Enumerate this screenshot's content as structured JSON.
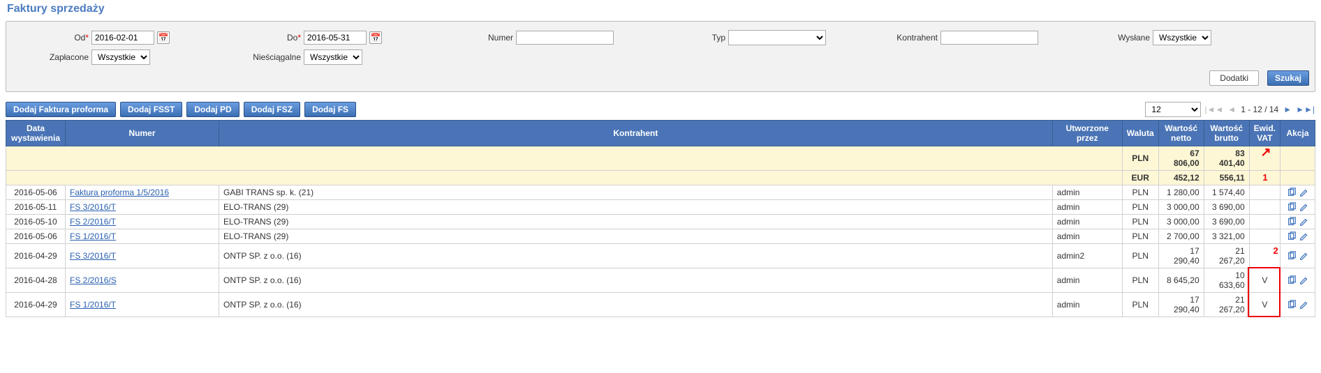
{
  "title": "Faktury sprzedaży",
  "filters": {
    "od": {
      "label": "Od",
      "value": "2016-02-01"
    },
    "do": {
      "label": "Do",
      "value": "2016-05-31"
    },
    "numer": {
      "label": "Numer",
      "value": ""
    },
    "typ": {
      "label": "Typ",
      "value": ""
    },
    "kontrahent": {
      "label": "Kontrahent",
      "value": ""
    },
    "wyslane": {
      "label": "Wysłane",
      "value": "Wszystkie"
    },
    "zaplacone": {
      "label": "Zapłacone",
      "value": "Wszystkie"
    },
    "niesciagalne": {
      "label": "Nieściągalne",
      "value": "Wszystkie"
    },
    "dodatki": "Dodatki",
    "szukaj": "Szukaj"
  },
  "actions": {
    "proforma": "Dodaj Faktura proforma",
    "fsst": "Dodaj FSST",
    "pd": "Dodaj PD",
    "fsz": "Dodaj FSZ",
    "fs": "Dodaj FS"
  },
  "pager": {
    "page_size": "12",
    "status": "1 - 12 / 14"
  },
  "columns": {
    "date": "Data wystawienia",
    "numer": "Numer",
    "kontrahent": "Kontrahent",
    "utworzone": "Utworzone przez",
    "waluta": "Waluta",
    "netto": "Wartość netto",
    "brutto": "Wartość brutto",
    "ewid": "Ewid. VAT",
    "akcja": "Akcja"
  },
  "summary": [
    {
      "waluta": "PLN",
      "netto": "67 806,00",
      "brutto": "83 401,40"
    },
    {
      "waluta": "EUR",
      "netto": "452,12",
      "brutto": "556,11"
    }
  ],
  "rows": [
    {
      "date": "2016-05-06",
      "numer": "Faktura proforma 1/5/2016",
      "kontrahent": "GABI TRANS sp. k. (21)",
      "user": "admin",
      "waluta": "PLN",
      "netto": "1 280,00",
      "brutto": "1 574,40",
      "ewid": ""
    },
    {
      "date": "2016-05-11",
      "numer": "FS 3/2016/T",
      "kontrahent": "ELO-TRANS (29)",
      "user": "admin",
      "waluta": "PLN",
      "netto": "3 000,00",
      "brutto": "3 690,00",
      "ewid": ""
    },
    {
      "date": "2016-05-10",
      "numer": "FS 2/2016/T",
      "kontrahent": "ELO-TRANS (29)",
      "user": "admin",
      "waluta": "PLN",
      "netto": "3 000,00",
      "brutto": "3 690,00",
      "ewid": ""
    },
    {
      "date": "2016-05-06",
      "numer": "FS 1/2016/T",
      "kontrahent": "ELO-TRANS (29)",
      "user": "admin",
      "waluta": "PLN",
      "netto": "2 700,00",
      "brutto": "3 321,00",
      "ewid": ""
    },
    {
      "date": "2016-04-29",
      "numer": "FS 3/2016/T",
      "kontrahent": "ONTP SP. z o.o. (16)",
      "user": "admin2",
      "waluta": "PLN",
      "netto": "17 290,40",
      "brutto": "21 267,20",
      "ewid": ""
    },
    {
      "date": "2016-04-28",
      "numer": "FS 2/2016/S",
      "kontrahent": "ONTP SP. z o.o. (16)",
      "user": "admin",
      "waluta": "PLN",
      "netto": "8 645,20",
      "brutto": "10 633,60",
      "ewid": "V"
    },
    {
      "date": "2016-04-29",
      "numer": "FS 1/2016/T",
      "kontrahent": "ONTP SP. z o.o. (16)",
      "user": "admin",
      "waluta": "PLN",
      "netto": "17 290,40",
      "brutto": "21 267,20",
      "ewid": "V"
    }
  ],
  "annotations": {
    "arrow": "↗",
    "n1": "1",
    "n2": "2"
  }
}
